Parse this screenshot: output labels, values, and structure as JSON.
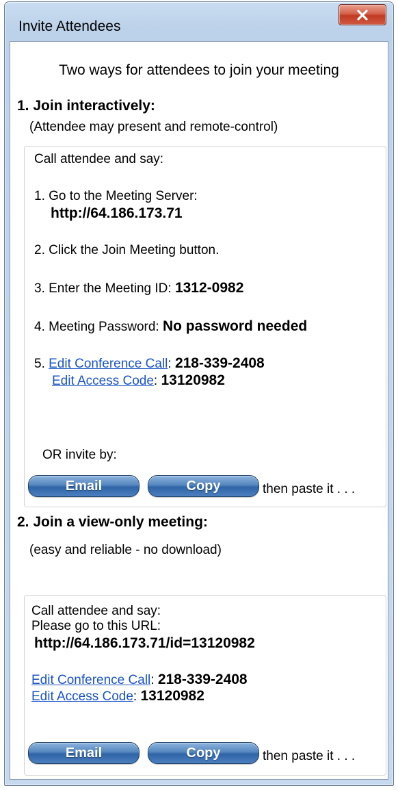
{
  "window": {
    "title": "Invite Attendees"
  },
  "intro": "Two ways for attendees to join your meeting",
  "section1": {
    "heading": "1. Join interactively:",
    "subtitle": "(Attendee may present and remote-control)",
    "call_label": "Call attendee and say:",
    "step1_label": "1. Go to the Meeting Server:",
    "server_url": "http://64.186.173.71",
    "step2_label": "2. Click the Join Meeting button.",
    "step3_label": "3. Enter the Meeting ID: ",
    "meeting_id": "1312-0982",
    "step4_label": "4. Meeting Password: ",
    "password_text": "No password needed",
    "step5_prefix": "5. ",
    "edit_conference_link": "Edit Conference Call",
    "conference_number": "218-339-2408",
    "edit_access_link": "Edit Access Code",
    "access_code": "13120982",
    "or_invite_label": "OR invite by:",
    "email_button": "Email",
    "copy_button": "Copy",
    "then_paste": "then paste it . . ."
  },
  "section2": {
    "heading": "2. Join a view-only meeting:",
    "subtitle": "(easy and reliable - no download)",
    "call_label": "Call attendee and say:",
    "url_label": "Please go to this URL:",
    "view_url": "http://64.186.173.71/id=13120982",
    "edit_conference_link": "Edit Conference Call",
    "conference_number": "218-339-2408",
    "edit_access_link": "Edit Access Code",
    "access_code": "13120982",
    "email_button": "Email",
    "copy_button": "Copy",
    "then_paste": "then paste it . . ."
  },
  "colors": {
    "link": "#1a54c6",
    "button_blue": "#3f74b6",
    "close_red": "#c13a22"
  }
}
